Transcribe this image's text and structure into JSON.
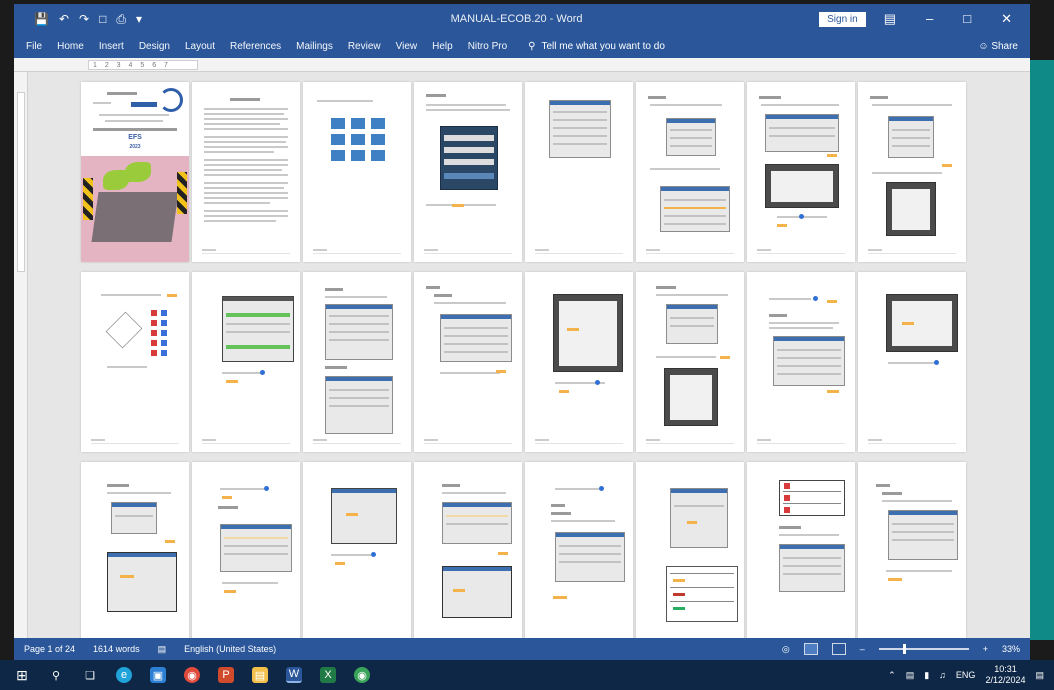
{
  "window": {
    "title": "MANUAL-ECOB.20 - Word",
    "sign_in": "Sign in",
    "qat": [
      "save",
      "undo",
      "redo",
      "new",
      "print",
      "customize"
    ]
  },
  "ribbon": {
    "tabs": [
      "File",
      "Home",
      "Insert",
      "Design",
      "Layout",
      "References",
      "Mailings",
      "Review",
      "View",
      "Help",
      "Nitro Pro"
    ],
    "tell_me": "Tell me what you want to do",
    "share": "Share"
  },
  "ruler": {
    "marks": "1 2 3 4 5 6 7"
  },
  "cover": {
    "title": "EFS",
    "subtitle": "2023"
  },
  "statusbar": {
    "page_info": "Page 1 of 24",
    "word_count": "1614 words",
    "language": "English (United States)",
    "zoom": "33%"
  },
  "taskbar": {
    "apps": [
      "windows-icon",
      "search-icon",
      "task-view-icon",
      "edge-icon",
      "store-icon",
      "chrome-icon",
      "powerpoint-icon",
      "file-explorer-icon",
      "word-icon",
      "excel-icon",
      "chrome-icon"
    ],
    "time": "10:31",
    "date": "2/12/2024",
    "lang": "ENG"
  },
  "colors": {
    "word_blue": "#2b579a",
    "highlight": "#f3b24a",
    "teal": "#0f8a87"
  }
}
